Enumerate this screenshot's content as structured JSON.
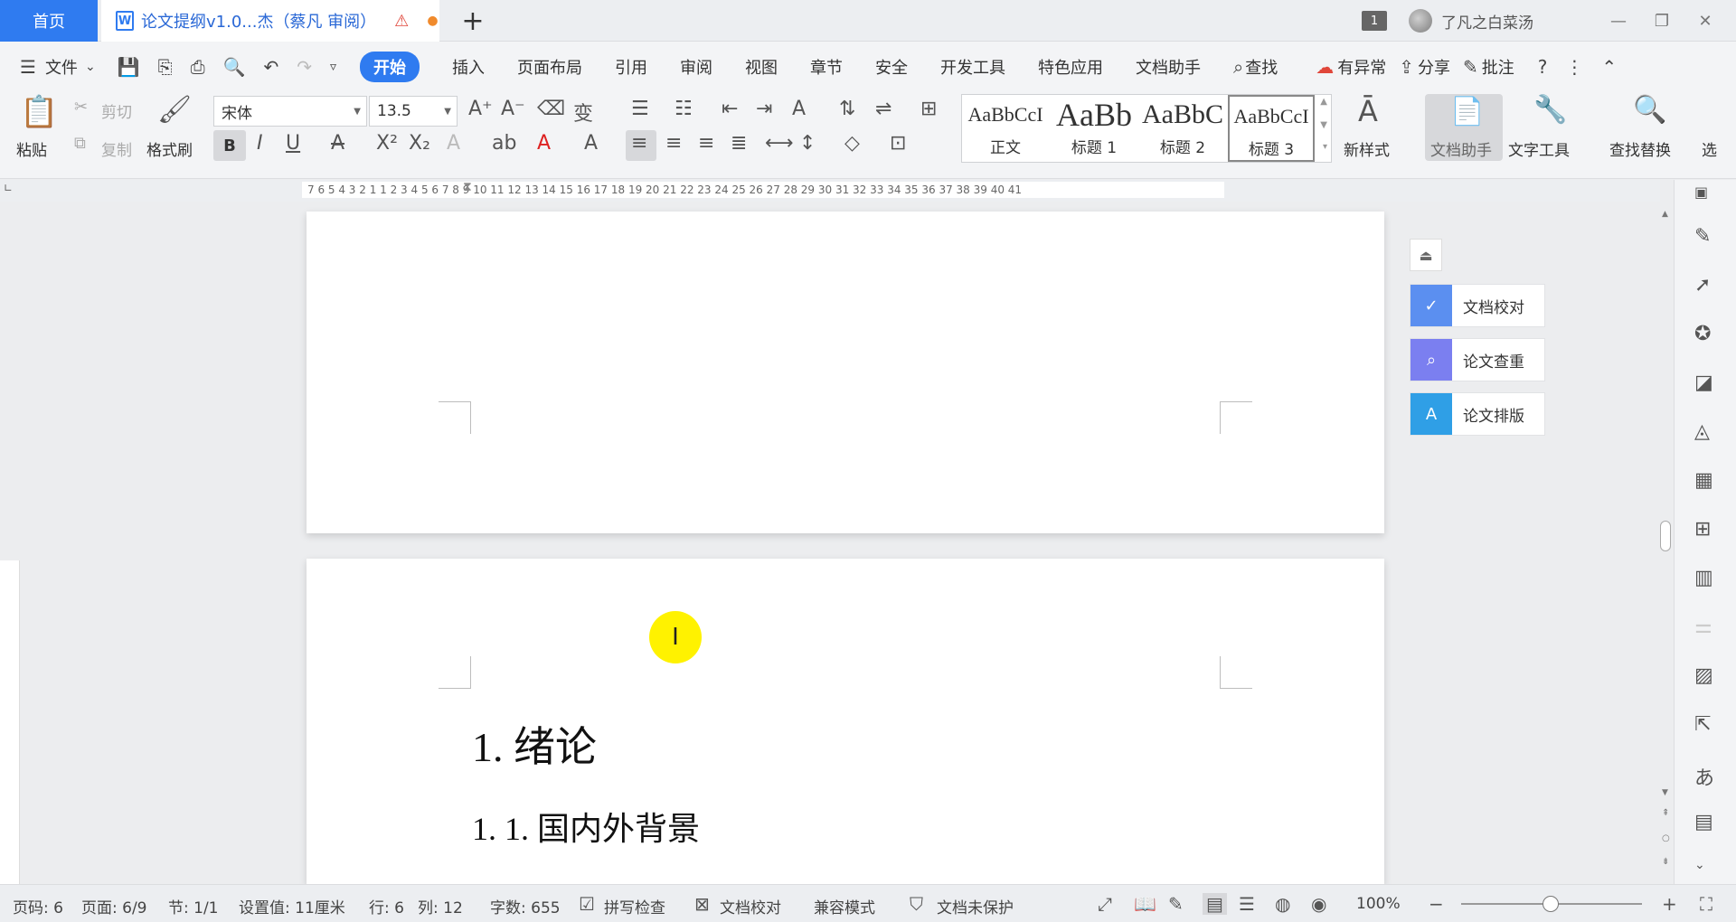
{
  "tabs": {
    "home": "首页",
    "document": "论文提纲v1.0...杰（蔡凡 审阅）",
    "window_count": "1",
    "username": "了凡之白菜汤"
  },
  "menu": {
    "file": "文件",
    "items": [
      "开始",
      "插入",
      "页面布局",
      "引用",
      "审阅",
      "视图",
      "章节",
      "安全",
      "开发工具",
      "特色应用",
      "文档助手"
    ],
    "search": "查找",
    "anomaly": "有异常",
    "share": "分享",
    "comment": "批注"
  },
  "ribbon": {
    "paste": "粘贴",
    "cut": "剪切",
    "copy": "复制",
    "format_painter": "格式刷",
    "font_name": "宋体",
    "font_size": "13.5",
    "styles": [
      {
        "sample": "AaBbCcI",
        "name": "正文"
      },
      {
        "sample": "AaBb",
        "name": "标题 1"
      },
      {
        "sample": "AaBbC",
        "name": "标题 2"
      },
      {
        "sample": "AaBbCcI",
        "name": "标题 3"
      }
    ],
    "new_style": "新样式",
    "doc_assistant": "文档助手",
    "text_tools": "文字工具",
    "find_replace": "查找替换",
    "select": "选"
  },
  "ruler": {
    "numbers": "7  6  5  4  3  2  1     1  2  3  4  5  6  7  8  9  10 11 12 13 14 15 16 17 18 19 20 21 22 23 24 25 26 27 28 29 30 31 32 33 34 35 36 37 38 39 40 41"
  },
  "document": {
    "heading1": "1.    绪论",
    "heading2": "1. 1.    国内外背景"
  },
  "float_panel": {
    "proofread": "文档校对",
    "plagiarism": "论文查重",
    "typeset": "论文排版"
  },
  "status": {
    "page_code": "页码: 6",
    "page": "页面: 6/9",
    "section": "节: 1/1",
    "setting": "设置值: 11厘米",
    "row": "行: 6",
    "col": "列: 12",
    "words": "字数: 655",
    "spell": "拼写检查",
    "proof": "文档校对",
    "compat": "兼容模式",
    "protect": "文档未保护",
    "zoom": "100%"
  },
  "colors": {
    "accent": "#2f7bf0",
    "float_proof": "#5b8ff0",
    "float_plag": "#7b7ff0",
    "float_typeset": "#2f9fe6",
    "cursor_highlight": "#fff200"
  }
}
